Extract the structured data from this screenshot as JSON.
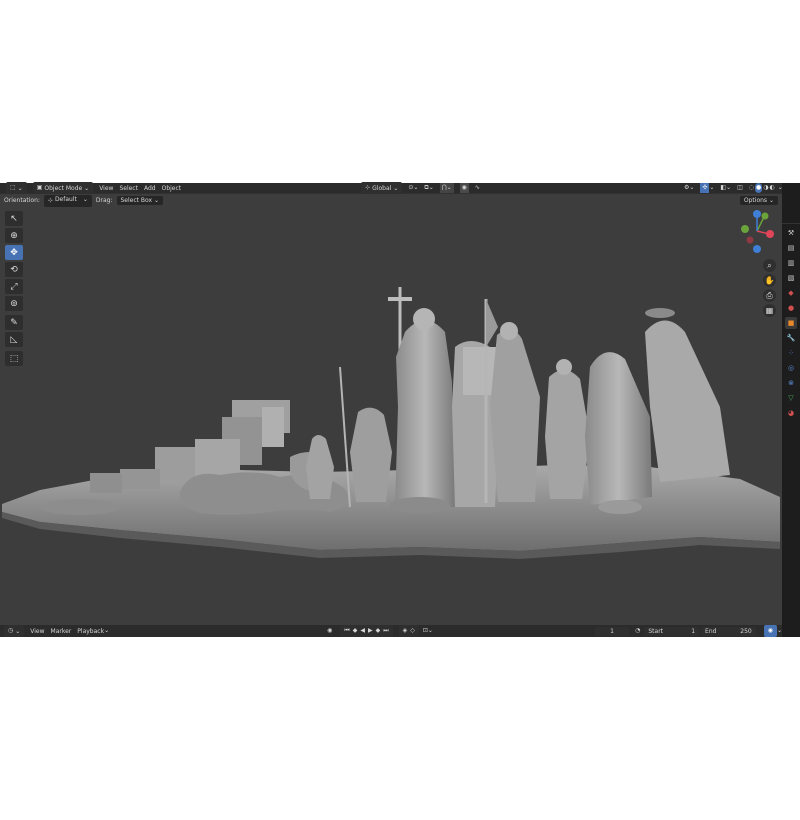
{
  "header": {
    "mode_label": "Object Mode",
    "menus": [
      "View",
      "Select",
      "Add",
      "Object"
    ],
    "orientation_global": "Global"
  },
  "tool_settings": {
    "orientation_label": "Orientation:",
    "orientation_value": "Default",
    "drag_label": "Drag:",
    "drag_value": "Select Box",
    "options_label": "Options"
  },
  "toolbar_tools": [
    {
      "name": "select-tool",
      "icon": "cursor-arrow-icon",
      "active": false
    },
    {
      "name": "cursor-tool",
      "icon": "3d-cursor-icon",
      "active": false
    },
    {
      "name": "move-tool",
      "icon": "move-arrows-icon",
      "active": true
    },
    {
      "name": "rotate-tool",
      "icon": "rotate-icon",
      "active": false
    },
    {
      "name": "scale-tool",
      "icon": "scale-icon",
      "active": false
    },
    {
      "name": "transform-tool",
      "icon": "transform-icon",
      "active": false
    },
    {
      "name": "annotate-tool",
      "icon": "pencil-icon",
      "active": false
    },
    {
      "name": "measure-tool",
      "icon": "ruler-icon",
      "active": false
    },
    {
      "name": "add-cube-tool",
      "icon": "cube-add-icon",
      "active": false
    }
  ],
  "gizmo": {
    "x_color": "#e0455a",
    "y_color": "#6aa33a",
    "z_color": "#3f7fd6"
  },
  "nav_buttons": [
    "zoom-icon",
    "hand-pan-icon",
    "camera-icon",
    "grid-icon"
  ],
  "timeline": {
    "menus": [
      "View",
      "Marker",
      "Playback"
    ],
    "current_frame": "1",
    "start_label": "Start",
    "start_value": "1",
    "end_label": "End",
    "end_value": "250"
  },
  "property_tabs": [
    {
      "name": "tool-icon",
      "color": "#cfcfcf"
    },
    {
      "name": "render-icon",
      "color": "#cfcfcf"
    },
    {
      "name": "output-icon",
      "color": "#cfcfcf"
    },
    {
      "name": "view-layer-icon",
      "color": "#cfcfcf"
    },
    {
      "name": "scene-icon",
      "color": "#d05050"
    },
    {
      "name": "world-icon",
      "color": "#d05050"
    },
    {
      "name": "object-icon",
      "color": "#e8892c"
    },
    {
      "name": "modifier-icon",
      "color": "#5b8dd6"
    },
    {
      "name": "particles-icon",
      "color": "#5b8dd6"
    },
    {
      "name": "physics-icon",
      "color": "#5b8dd6"
    },
    {
      "name": "constraints-icon",
      "color": "#5b8dd6"
    },
    {
      "name": "data-icon",
      "color": "#49b25a"
    },
    {
      "name": "material-icon",
      "color": "#d05050"
    }
  ],
  "colors": {
    "accent": "#4772b3",
    "viewport_bg": "#3d3d3d"
  }
}
